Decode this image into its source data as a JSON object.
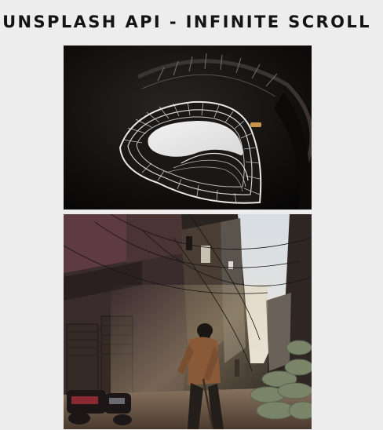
{
  "header": {
    "title": "UNSPLASH API - INFINITE SCROLL"
  },
  "photos": [
    {
      "subject": "spiral-staircase-skylight"
    },
    {
      "subject": "sunlit-alley-street-sweeper"
    }
  ],
  "colors": {
    "background": "#ededed",
    "title": "#141414"
  }
}
